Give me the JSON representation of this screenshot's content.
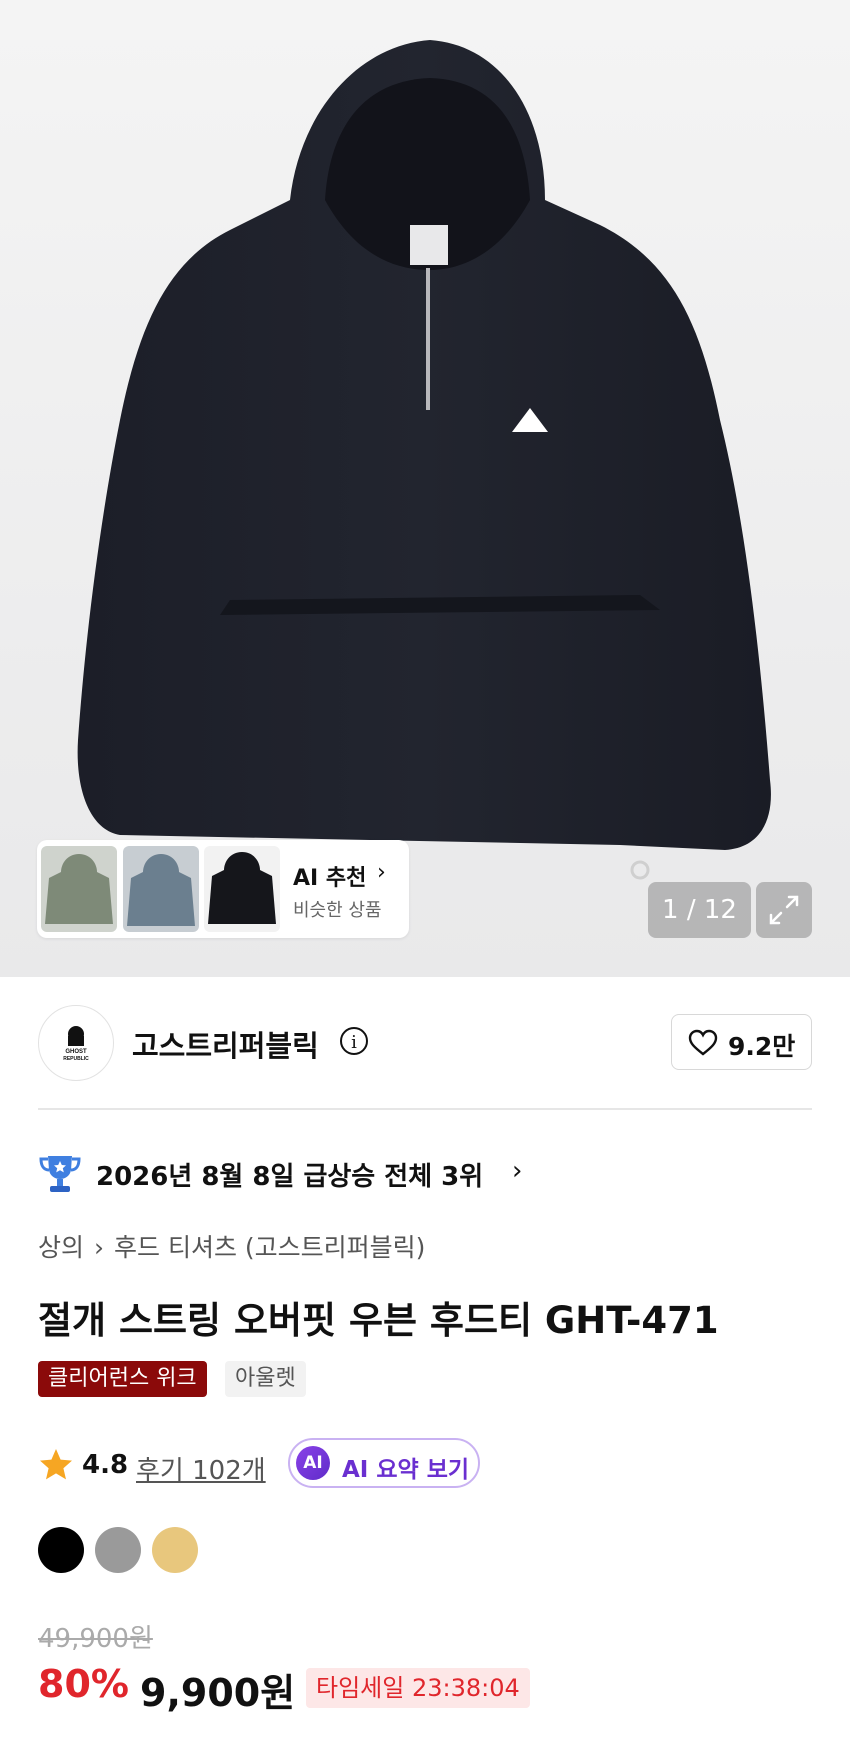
{
  "gallery": {
    "pager": "1 / 12",
    "ai_recommend": {
      "title": "AI 추천",
      "subtitle": "비슷한 상품"
    }
  },
  "brand": {
    "logo_text": "GHOST REPUBLIC",
    "name": "고스트리퍼블릭",
    "likes": "9.2만"
  },
  "ranking": {
    "text": "2026년 8월 8일 급상승 전체 3위"
  },
  "breadcrumb": [
    "상의",
    "후드 티셔츠 (고스트리퍼블릭)"
  ],
  "product": {
    "title": "절개 스트링 오버핏 우븐 후드티 GHT-471",
    "badges": {
      "clearance": "클리어런스 위크",
      "outlet": "아울렛"
    }
  },
  "rating": {
    "score": "4.8",
    "reviews": "후기 102개",
    "ai_summary": "AI 요약 보기",
    "ai_badge": "AI"
  },
  "colors": [
    "#000000",
    "#9a9a9a",
    "#e8c77d"
  ],
  "price": {
    "original": "49,900원",
    "discount": "80%",
    "sale": "9,900원",
    "timesale": "타임세일 23:38:04"
  }
}
